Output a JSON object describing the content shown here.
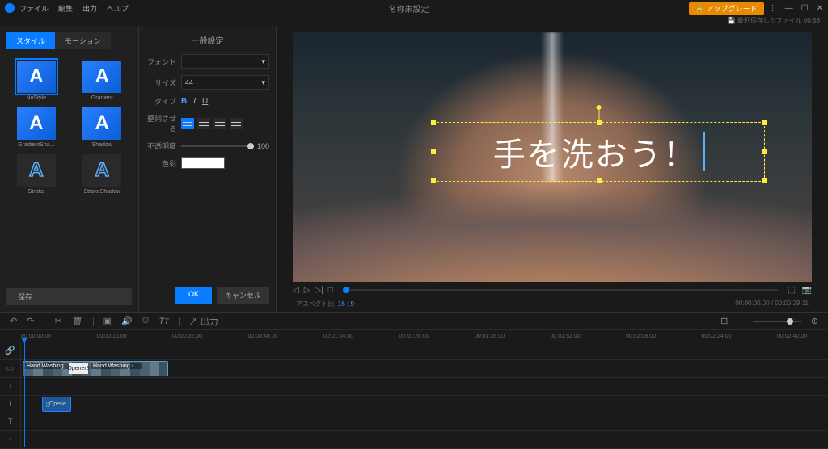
{
  "menus": {
    "file": "ファイル",
    "edit": "編集",
    "output": "出力",
    "help": "ヘルプ"
  },
  "window_title": "名称未設定",
  "upgrade": "アップグレード",
  "recent_label": "最近保存したファイル 00:58",
  "left": {
    "tab_style": "スタイル",
    "tab_motion": "モーション",
    "letter": "A",
    "styles": [
      "NoStyle",
      "Gradient",
      "GradientSha...",
      "Shadow",
      "Stroke",
      "StrokeShadow"
    ],
    "save": "保存"
  },
  "mid": {
    "header": "一般設定",
    "font_label": "フォント",
    "font_value": "",
    "size_label": "サイズ",
    "size_value": "44",
    "type_label": "タイプ",
    "align_label": "整列させる",
    "opacity_label": "不透明度",
    "opacity_value": "100",
    "color_label": "色彩",
    "ok": "OK",
    "cancel": "キャンセル"
  },
  "overlay_text": "手を洗おう！",
  "aspect": {
    "label": "アスペクト比",
    "value": "16 : 9"
  },
  "timecode": {
    "current": "00:00:00.00",
    "total": "00:00:29.11"
  },
  "tl_export": "出力",
  "ruler": [
    "00:00:00.00",
    "00:00:16.00",
    "00:00:32.00",
    "00:00:48.00",
    "00:01:04.00",
    "00:01:20.00",
    "00:01:36.00",
    "00:01:52.00",
    "00:02:08.00",
    "00:02:24.00",
    "00:02:40.00"
  ],
  "clips": {
    "v1_label": "Hand Washing ...",
    "v1_white": "Opener9",
    "v1_label2": "Hand Washing - ...",
    "t1_label": "Opene..."
  }
}
